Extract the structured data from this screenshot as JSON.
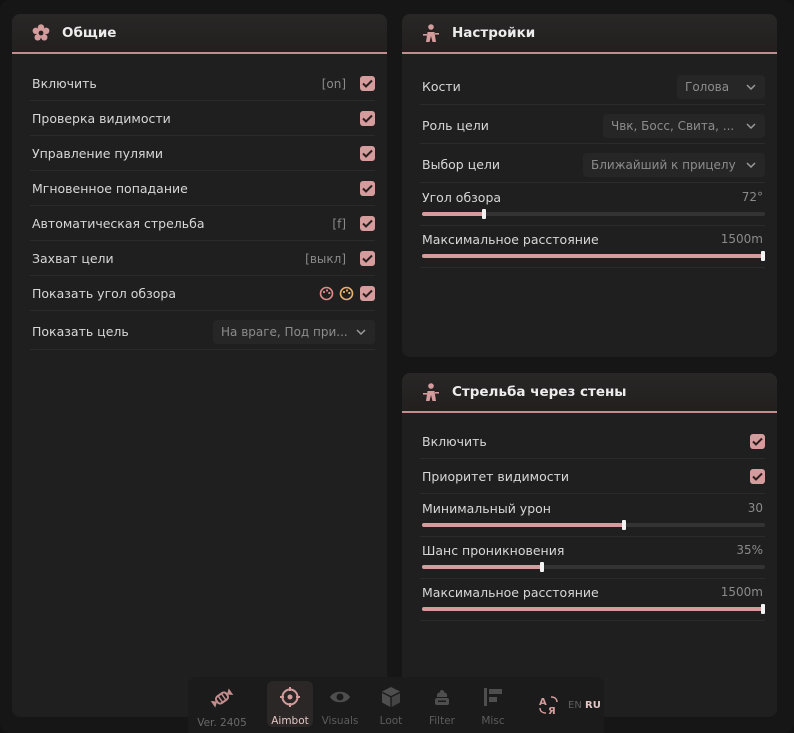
{
  "colors": {
    "accent": "#d49c9c",
    "panel": "#1f1f1f",
    "background": "#161616"
  },
  "general": {
    "title": "Общие",
    "icon": "gear-flower-icon",
    "rows": [
      {
        "label": "Включить",
        "key": "[on]",
        "checked": true
      },
      {
        "label": "Проверка видимости",
        "key": "",
        "checked": true
      },
      {
        "label": "Управление пулями",
        "key": "",
        "checked": true
      },
      {
        "label": "Мгновенное попадание",
        "key": "",
        "checked": true
      },
      {
        "label": "Автоматическая стрельба",
        "key": "[f]",
        "checked": true
      },
      {
        "label": "Захват цели",
        "key": "[выкл]",
        "checked": true
      },
      {
        "label": "Показать угол обзора",
        "key": "",
        "checked": true
      }
    ],
    "show_target": {
      "label": "Показать цель",
      "value": "На враге, Под при..."
    }
  },
  "settings": {
    "title": "Настройки",
    "bones": {
      "label": "Кости",
      "value": "Голова"
    },
    "target_role": {
      "label": "Роль цели",
      "value": "Чвк, Босс, Свита, ..."
    },
    "target_select": {
      "label": "Выбор цели",
      "value": "Ближайший к прицелу"
    },
    "fov": {
      "label": "Угол обзора",
      "value": "72°",
      "fraction": 0.18
    },
    "max_distance": {
      "label": "Максимальное расстояние",
      "value": "1500m",
      "fraction": 1.0
    }
  },
  "wallshot": {
    "title": "Стрельба через стены",
    "enable": {
      "label": "Включить",
      "checked": true
    },
    "visibility_priority": {
      "label": "Приоритет видимости",
      "checked": true
    },
    "min_damage": {
      "label": "Минимальный урон",
      "value": "30",
      "fraction": 0.59
    },
    "penetration": {
      "label": "Шанс проникновения",
      "value": "35%",
      "fraction": 0.35
    },
    "max_distance": {
      "label": "Максимальное расстояние",
      "value": "1500m",
      "fraction": 1.0
    }
  },
  "nav": {
    "version": "Ver. 2405",
    "items": [
      {
        "label": "Aimbot",
        "icon": "crosshair-icon",
        "active": true
      },
      {
        "label": "Visuals",
        "icon": "eye-icon",
        "active": false
      },
      {
        "label": "Loot",
        "icon": "box-icon",
        "active": false
      },
      {
        "label": "Filter",
        "icon": "filter-icon",
        "active": false
      },
      {
        "label": "Misc",
        "icon": "misc-icon",
        "active": false
      }
    ],
    "lang_en": "EN",
    "lang_ru": "RU"
  }
}
